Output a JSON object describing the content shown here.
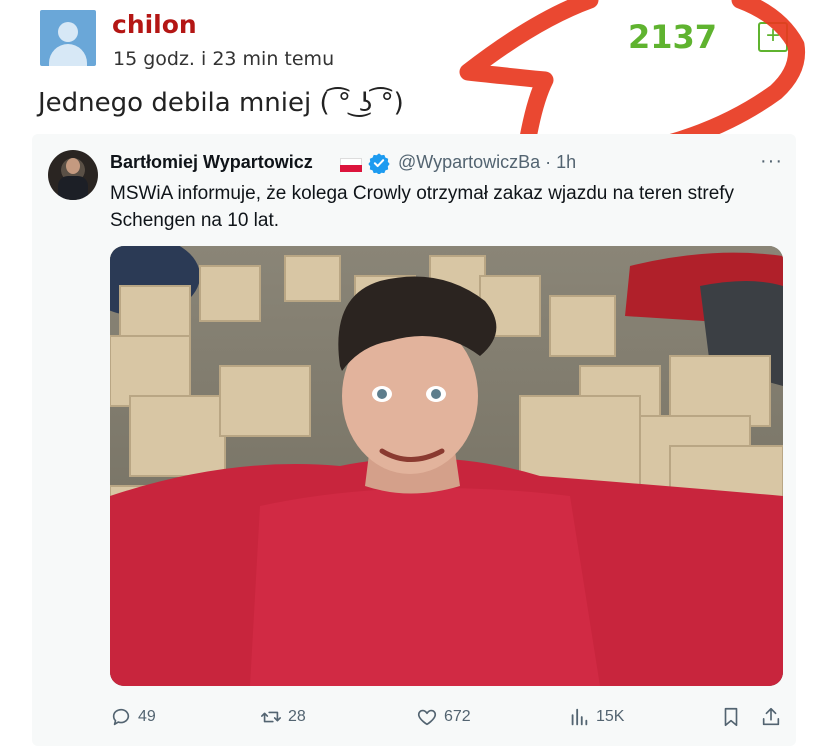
{
  "post": {
    "username": "chilon",
    "timestamp": "15 godz. i 23 min temu",
    "votes": "2137",
    "plus_label": "+",
    "text": "Jednego debila mniej ( ͡° ͜ʖ ͡°)"
  },
  "tweet": {
    "author_name": "Bartłomiej Wypartowicz",
    "handle": "@WypartowiczBa · 1h",
    "more": "···",
    "text": "MSWiA informuje, że kolega Crowly otrzymał zakaz wjazdu na teren strefy Schengen na 10 lat.",
    "actions": {
      "replies": "49",
      "retweets": "28",
      "likes": "672",
      "views": "15K"
    }
  },
  "colors": {
    "username": "#b41614",
    "votes": "#5fb32f",
    "annotation": "#e8381f",
    "tweet_bg": "#f7f9f9",
    "verified": "#1d9bf0"
  }
}
